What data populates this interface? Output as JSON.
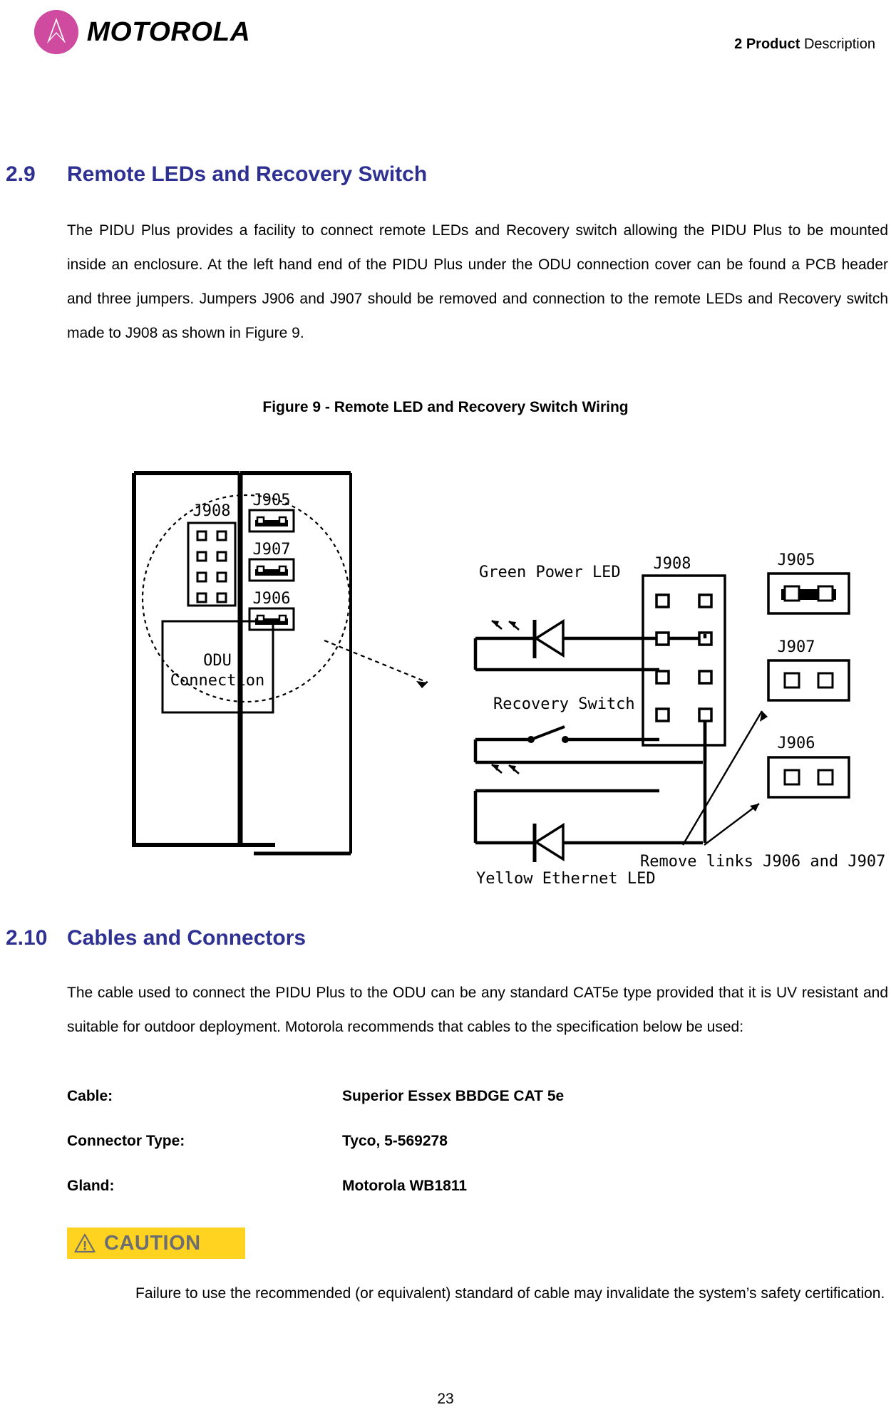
{
  "header": {
    "logo_text": "MOTOROLA",
    "logo_icon": "motorola-batwing-icon",
    "logo_color": "#cf4ba0",
    "chapter_number": "2 Product",
    "chapter_title": "Description"
  },
  "sections": {
    "s29": {
      "number": "2.9",
      "title": "Remote LEDs and Recovery Switch",
      "body": "The PIDU Plus provides a facility to connect remote LEDs and Recovery switch allowing the PIDU Plus to be mounted inside an enclosure. At the left hand end of the PIDU Plus under the ODU connection cover can be found a PCB header and three jumpers. Jumpers J906 and J907 should be removed and connection to the remote LEDs and Recovery switch made to J908 as shown in Figure 9."
    },
    "s210": {
      "number": "2.10",
      "title": "Cables and Connectors",
      "body": "The cable used to connect the PIDU Plus to the ODU can be any standard CAT5e type provided that it is UV resistant and suitable for outdoor deployment. Motorola recommends that cables to the specification below be used:"
    }
  },
  "figure": {
    "caption": "Figure 9 - Remote LED and Recovery Switch Wiring",
    "pcb_view": {
      "header_label": "J908",
      "jumper_labels": [
        "J905",
        "J907",
        "J906"
      ],
      "odu_box_line1": "ODU",
      "odu_box_line2": "Connection"
    },
    "wiring_view": {
      "green_led_label": "Green Power LED",
      "recovery_switch_label": "Recovery Switch",
      "yellow_led_label": "Yellow Ethernet LED",
      "connector_label": "J908",
      "jumper_labels": [
        "J905",
        "J907",
        "J906"
      ],
      "note": "Remove links J906 and J907"
    }
  },
  "spec_table": {
    "rows": [
      {
        "label": "Cable:",
        "value": "Superior Essex BBDGE CAT 5e"
      },
      {
        "label": "Connector Type:",
        "value": "Tyco, 5-569278"
      },
      {
        "label": "Gland:",
        "value": "Motorola WB1811"
      }
    ]
  },
  "caution": {
    "badge_label": "CAUTION",
    "badge_bg": "#ffd320",
    "badge_fg": "#6d6e71",
    "body": "Failure to use the recommended (or equivalent) standard of cable may invalidate the system’s safety certification."
  },
  "footer": {
    "page_number": "23"
  }
}
